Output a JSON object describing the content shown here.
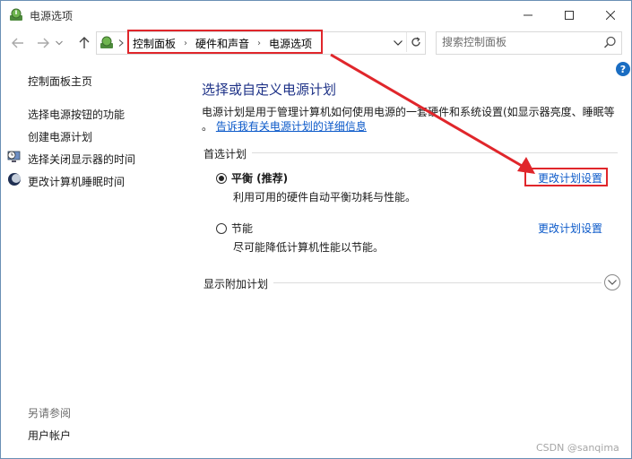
{
  "window": {
    "title": "电源选项"
  },
  "address_bar": {
    "crumbs": [
      "控制面板",
      "硬件和声音",
      "电源选项"
    ]
  },
  "search": {
    "placeholder": "搜索控制面板"
  },
  "sidebar": {
    "home": "控制面板主页",
    "items": [
      {
        "label": "选择电源按钮的功能",
        "icon": "none"
      },
      {
        "label": "创建电源计划",
        "icon": "none"
      },
      {
        "label": "选择关闭显示器的时间",
        "icon": "monitor-clock-icon"
      },
      {
        "label": "更改计算机睡眠时间",
        "icon": "moon-icon"
      }
    ],
    "see_also_title": "另请参阅",
    "see_also_items": [
      "用户帐户"
    ]
  },
  "main": {
    "heading": "选择或自定义电源计划",
    "description_line1": "电源计划是用于管理计算机如何使用电源的一套硬件和系统设置(如显示器亮度、睡眠等",
    "description_line2_prefix": "。",
    "description_link": "告诉我有关电源计划的详细信息",
    "preferred_plans_label": "首选计划",
    "plans": [
      {
        "name": "平衡 (推荐)",
        "description": "利用可用的硬件自动平衡功耗与性能。",
        "selected": true,
        "change_link": "更改计划设置"
      },
      {
        "name": "节能",
        "description": "尽可能降低计算机性能以节能。",
        "selected": false,
        "change_link": "更改计划设置"
      }
    ],
    "additional_plans_label": "显示附加计划"
  },
  "annotations": {
    "highlight_color": "#e0262b"
  },
  "watermark": "CSDN @sanqima",
  "colors": {
    "heading": "#1e3287",
    "link": "#0b59c9"
  }
}
